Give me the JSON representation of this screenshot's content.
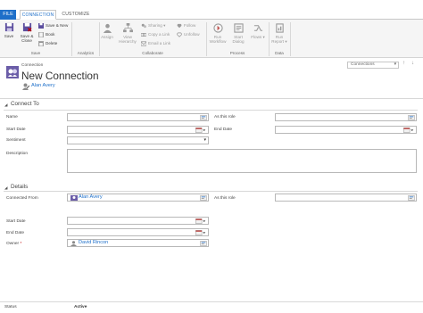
{
  "tabs": {
    "file": "FILE",
    "connection": "CONNECTION",
    "customize": "CUSTOMIZE"
  },
  "ribbon": {
    "save": "Save",
    "save_close": "Save &\nClose",
    "save_new": "Save & New",
    "book": "Book",
    "delete": "Delete",
    "group_save": "Save",
    "group_analytics": "Analytics",
    "assign": "Assign",
    "view_hierarchy": "View\nHierarchy",
    "sharing": "Sharing",
    "copy_link": "Copy a Link",
    "email_link": "Email a Link",
    "follow": "Follow",
    "unfollow": "Unfollow",
    "group_collaborate": "Collaborate",
    "run_workflow": "Run\nWorkflow",
    "start_dialog": "Start\nDialog",
    "flows": "Flows",
    "group_process": "Process",
    "run_report": "Run\nReport",
    "group_data": "Data"
  },
  "header": {
    "entity": "Connection",
    "title": "New Connection",
    "owner_link": "Alan Avery",
    "form_selector": "Connections"
  },
  "connect_to": {
    "title": "Connect To",
    "name_label": "Name",
    "as_this_role_label": "As this role",
    "start_date_label": "Start Date",
    "end_date_label": "End Date",
    "sentiment_label": "Sentiment",
    "description_label": "Description"
  },
  "details": {
    "title": "Details",
    "connected_from_label": "Connected From",
    "connected_from_value": "Alan Avery",
    "as_this_role_label": "As this role",
    "start_date_label": "Start Date",
    "end_date_label": "End Date",
    "owner_label": "Owner",
    "required_mark": "*",
    "owner_value": "David Rincon"
  },
  "status": {
    "label": "Status",
    "value": "Active"
  },
  "colors": {
    "accent": "#1e6fc9",
    "required": "#c00000"
  }
}
